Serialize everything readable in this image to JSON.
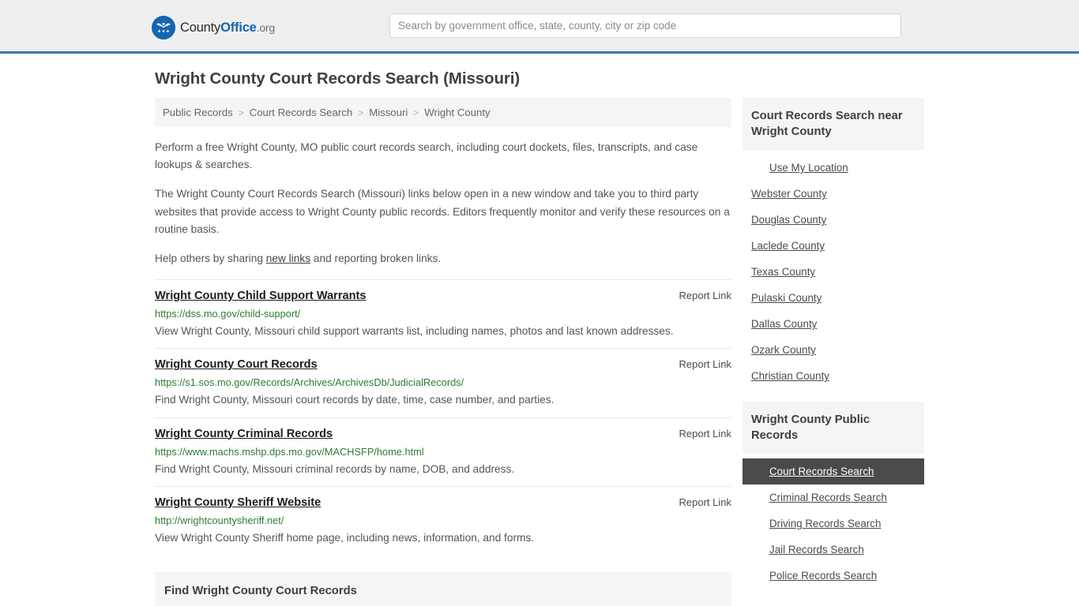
{
  "header": {
    "logo": {
      "icon": "eagle-shield-icon",
      "text_part1": "County",
      "text_part2": "Office",
      "text_part3": ".org"
    },
    "search": {
      "placeholder": "Search by government office, state, county, city or zip code",
      "value": ""
    },
    "accent_color": "#3c77ab",
    "background_color": "#efefef"
  },
  "page": {
    "title": "Wright County Court Records Search (Missouri)"
  },
  "breadcrumb": {
    "separator": ">",
    "items": [
      {
        "label": "Public Records"
      },
      {
        "label": "Court Records Search"
      },
      {
        "label": "Missouri"
      },
      {
        "label": "Wright County"
      }
    ]
  },
  "intro": {
    "paragraph1": "Perform a free Wright County, MO public court records search, including court dockets, files, transcripts, and case lookups & searches.",
    "paragraph2": "The Wright County Court Records Search (Missouri) links below open in a new window and take you to third party websites that provide access to Wright County public records. Editors frequently monitor and verify these resources on a routine basis.",
    "paragraph3_before": "Help others by sharing ",
    "paragraph3_link": "new links",
    "paragraph3_after": " and reporting broken links."
  },
  "results": {
    "report_label": "Report Link",
    "items": [
      {
        "title": "Wright County Child Support Warrants",
        "url": "https://dss.mo.gov/child-support/",
        "description": "View Wright County, Missouri child support warrants list, including names, photos and last known addresses."
      },
      {
        "title": "Wright County Court Records",
        "url": "https://s1.sos.mo.gov/Records/Archives/ArchivesDb/JudicialRecords/",
        "description": "Find Wright County, Missouri court records by date, time, case number, and parties."
      },
      {
        "title": "Wright County Criminal Records",
        "url": "https://www.machs.mshp.dps.mo.gov/MACHSFP/home.html",
        "description": "Find Wright County, Missouri criminal records by name, DOB, and address."
      },
      {
        "title": "Wright County Sheriff Website",
        "url": "http://wrightcountysheriff.net/",
        "description": "View Wright County Sheriff home page, including news, information, and forms."
      }
    ]
  },
  "find_section": {
    "title": "Find Wright County Court Records"
  },
  "sidebar": {
    "nearby_panel": {
      "heading": "Court Records Search near Wright County",
      "use_my_location": "Use My Location",
      "counties": [
        {
          "label": "Webster County"
        },
        {
          "label": "Douglas County"
        },
        {
          "label": "Laclede County"
        },
        {
          "label": "Texas County"
        },
        {
          "label": "Pulaski County"
        },
        {
          "label": "Dallas County"
        },
        {
          "label": "Ozark County"
        },
        {
          "label": "Christian County"
        }
      ]
    },
    "public_records_panel": {
      "heading": "Wright County Public Records",
      "active_color": "#4a4a4a",
      "links": [
        {
          "label": "Court Records Search",
          "active": true
        },
        {
          "label": "Criminal Records Search",
          "active": false
        },
        {
          "label": "Driving Records Search",
          "active": false
        },
        {
          "label": "Jail Records Search",
          "active": false
        },
        {
          "label": "Police Records Search",
          "active": false
        }
      ]
    }
  }
}
